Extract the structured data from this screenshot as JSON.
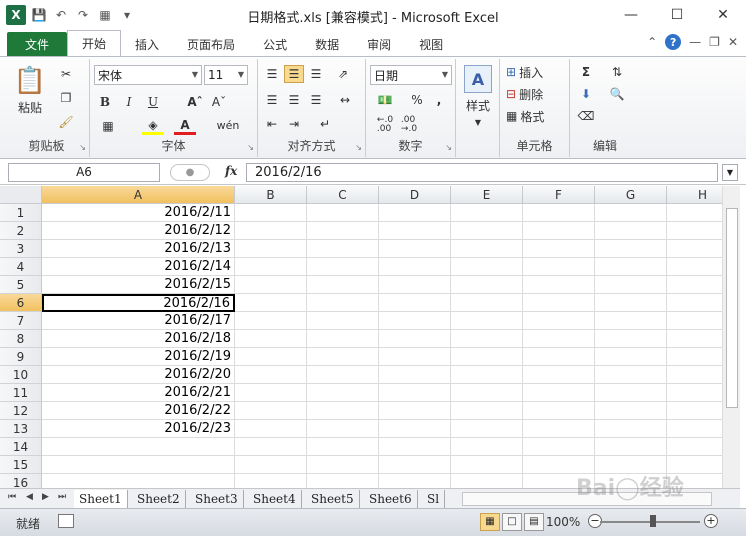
{
  "window": {
    "title": "日期格式.xls  [兼容模式]  -  Microsoft Excel",
    "app_icon": "excel-icon"
  },
  "tabs": [
    {
      "label": "文件"
    },
    {
      "label": "开始"
    },
    {
      "label": "插入"
    },
    {
      "label": "页面布局"
    },
    {
      "label": "公式"
    },
    {
      "label": "数据"
    },
    {
      "label": "审阅"
    },
    {
      "label": "视图"
    }
  ],
  "ribbon": {
    "clipboard": {
      "paste": "粘贴",
      "label": "剪贴板"
    },
    "font": {
      "name": "宋体",
      "size": "11",
      "label": "字体",
      "bold": "B",
      "italic": "I",
      "underline": "U",
      "wen": "wén"
    },
    "alignment": {
      "label": "对齐方式"
    },
    "number": {
      "format": "日期",
      "percent": "%",
      "comma": ",",
      "label": "数字",
      "inc": "←.0\n.00",
      "dec": ".00\n→.0"
    },
    "styles": {
      "label": "样式"
    },
    "cells": {
      "insert": "插入",
      "delete": "删除",
      "format": "格式",
      "label": "单元格"
    },
    "editing": {
      "label": "编辑",
      "sigma": "Σ"
    }
  },
  "formula_bar": {
    "name_box": "A6",
    "fx": "fx",
    "content": "2016/2/16"
  },
  "columns": [
    "A",
    "B",
    "C",
    "D",
    "E",
    "F",
    "G",
    "H"
  ],
  "rows": [
    "1",
    "2",
    "3",
    "4",
    "5",
    "6",
    "7",
    "8",
    "9",
    "10",
    "11",
    "12",
    "13",
    "14",
    "15",
    "16"
  ],
  "cells_A": [
    "2016/2/11",
    "2016/2/12",
    "2016/2/13",
    "2016/2/14",
    "2016/2/15",
    "2016/2/16",
    "2016/2/17",
    "2016/2/18",
    "2016/2/19",
    "2016/2/20",
    "2016/2/21",
    "2016/2/22",
    "2016/2/23",
    "",
    "",
    ""
  ],
  "active_cell": {
    "col": "A",
    "row": "6"
  },
  "sheets": [
    "Sheet1",
    "Sheet2",
    "Sheet3",
    "Sheet4",
    "Sheet5",
    "Sheet6",
    "Sl"
  ],
  "status": {
    "ready": "就绪",
    "zoom": "100%"
  },
  "watermark": "Bai经验"
}
